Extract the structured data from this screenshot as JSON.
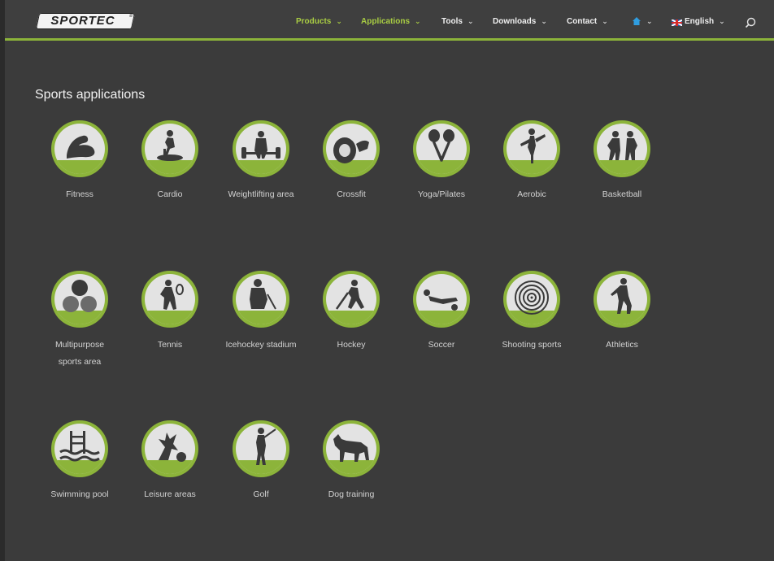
{
  "brand": {
    "logo_text": "SPORTEC",
    "logo_mark": "®"
  },
  "nav": {
    "items": [
      {
        "label": "Products",
        "active": true
      },
      {
        "label": "Applications",
        "active": true
      },
      {
        "label": "Tools",
        "active": false
      },
      {
        "label": "Downloads",
        "active": false
      },
      {
        "label": "Contact",
        "active": false
      }
    ],
    "home_icon": "home-icon",
    "language": "English",
    "search_icon": "search-icon"
  },
  "main": {
    "heading": "Sports applications",
    "applications": [
      {
        "label": "Fitness",
        "icon": "fitness-icon"
      },
      {
        "label": "Cardio",
        "icon": "cardio-icon"
      },
      {
        "label": "Weightlifting area",
        "icon": "weightlifting-icon"
      },
      {
        "label": "Crossfit",
        "icon": "crossfit-icon"
      },
      {
        "label": "Yoga/Pilates",
        "icon": "yoga-pilates-icon"
      },
      {
        "label": "Aerobic",
        "icon": "aerobic-icon"
      },
      {
        "label": "Basketball",
        "icon": "basketball-icon"
      },
      {
        "label": "Multipurpose sports area",
        "icon": "multipurpose-icon"
      },
      {
        "label": "Tennis",
        "icon": "tennis-icon"
      },
      {
        "label": "Icehockey stadium",
        "icon": "icehockey-icon"
      },
      {
        "label": "Hockey",
        "icon": "hockey-icon"
      },
      {
        "label": "Soccer",
        "icon": "soccer-icon"
      },
      {
        "label": "Shooting sports",
        "icon": "shooting-icon"
      },
      {
        "label": "Athletics",
        "icon": "athletics-icon"
      },
      {
        "label": "Swimming pool",
        "icon": "swimming-pool-icon"
      },
      {
        "label": "Leisure areas",
        "icon": "leisure-icon"
      },
      {
        "label": "Golf",
        "icon": "golf-icon"
      },
      {
        "label": "Dog training",
        "icon": "dog-training-icon"
      }
    ]
  },
  "colors": {
    "accent": "#8cb43a",
    "nav_active": "#a9cd43",
    "background": "#3b3b3b",
    "icon_fill": "#e6e6e6"
  }
}
